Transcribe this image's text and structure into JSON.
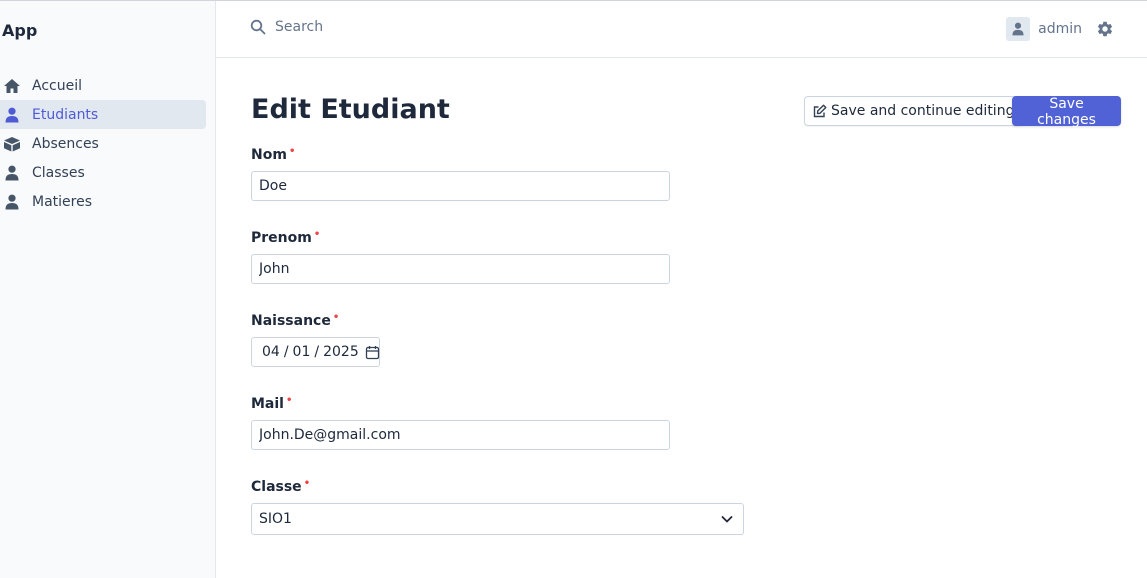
{
  "app": {
    "title": "App"
  },
  "sidebar": {
    "items": [
      {
        "label": "Accueil",
        "icon": "home-icon",
        "active": false
      },
      {
        "label": "Etudiants",
        "icon": "user-icon",
        "active": true
      },
      {
        "label": "Absences",
        "icon": "box-icon",
        "active": false
      },
      {
        "label": "Classes",
        "icon": "user-icon",
        "active": false
      },
      {
        "label": "Matieres",
        "icon": "user-icon",
        "active": false
      }
    ]
  },
  "header": {
    "search_placeholder": "Search",
    "username": "admin"
  },
  "page": {
    "title": "Edit Etudiant",
    "save_continue_label": "Save and continue editing",
    "save_label": "Save changes"
  },
  "form": {
    "nom": {
      "label": "Nom",
      "value": "Doe"
    },
    "prenom": {
      "label": "Prenom",
      "value": "John"
    },
    "naissance": {
      "label": "Naissance",
      "day": "04",
      "month": "01",
      "year": "2025"
    },
    "mail": {
      "label": "Mail",
      "value": "John.De@gmail.com"
    },
    "classe": {
      "label": "Classe",
      "value": "SIO1"
    },
    "required_mark": "•"
  },
  "colors": {
    "accent": "#5062d6",
    "active_nav_text": "#4f5bd5",
    "required": "#ef4444"
  }
}
